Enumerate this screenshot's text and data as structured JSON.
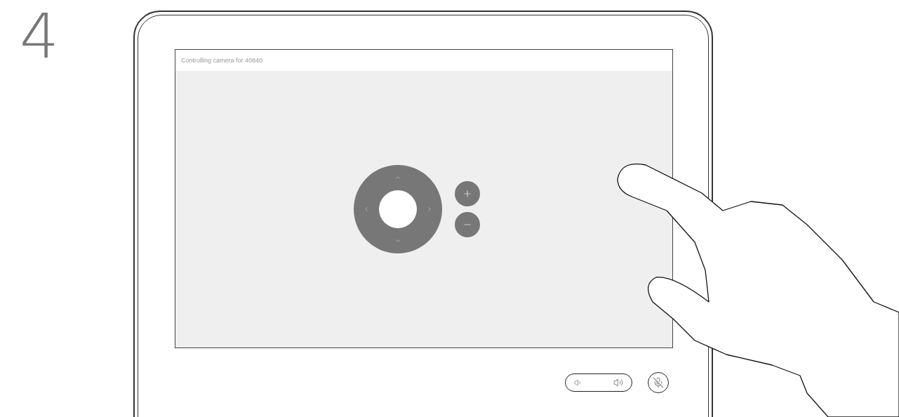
{
  "step": "4",
  "screen": {
    "title": "Controlling camera for 40840"
  },
  "microphone": {
    "muted": true
  }
}
